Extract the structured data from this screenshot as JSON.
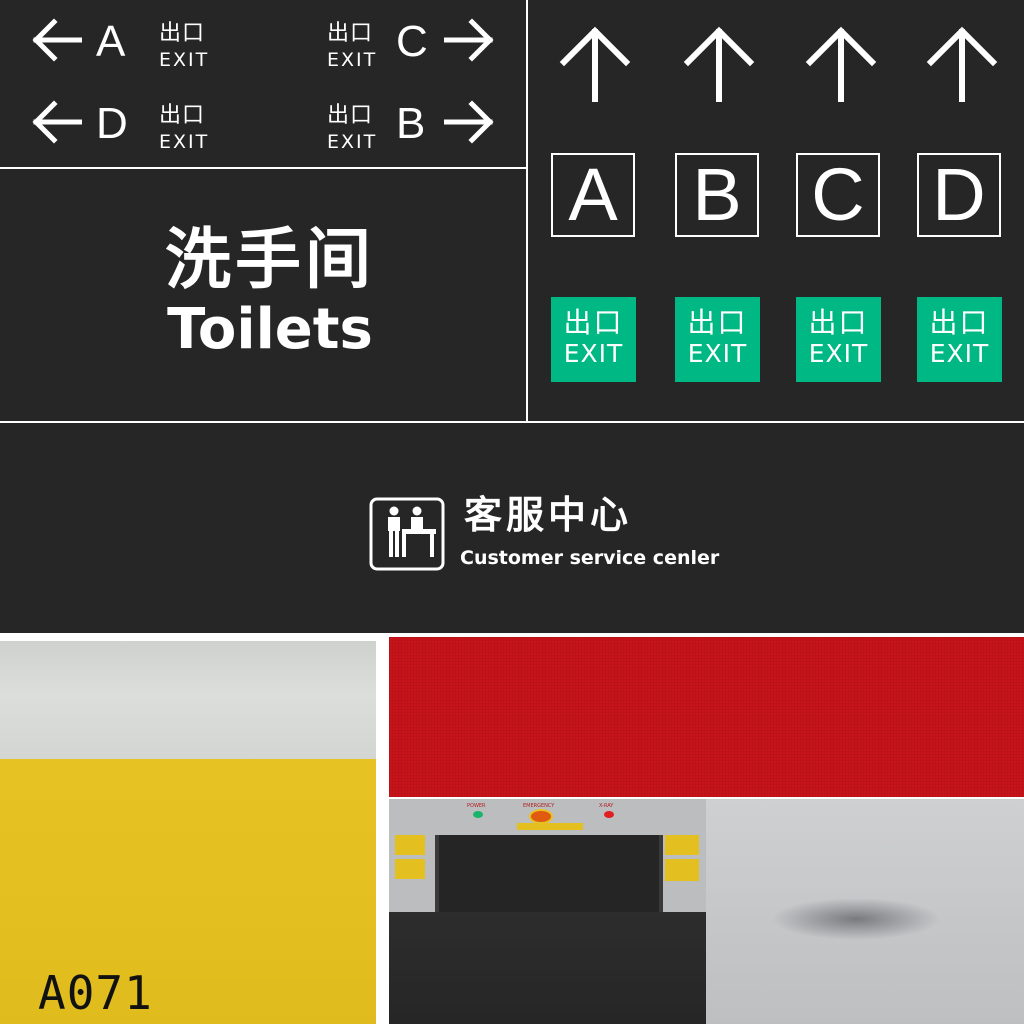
{
  "signs": {
    "exit_directions": [
      {
        "letter": "A",
        "zh": "出口",
        "en": "EXIT",
        "direction": "left"
      },
      {
        "letter": "C",
        "zh": "出口",
        "en": "EXIT",
        "direction": "right"
      },
      {
        "letter": "D",
        "zh": "出口",
        "en": "EXIT",
        "direction": "left"
      },
      {
        "letter": "B",
        "zh": "出口",
        "en": "EXIT",
        "direction": "right"
      }
    ],
    "toilets": {
      "zh": "洗手间",
      "en": "Toilets"
    },
    "gates": [
      {
        "letter": "A",
        "zh": "出口",
        "en": "EXIT"
      },
      {
        "letter": "B",
        "zh": "出口",
        "en": "EXIT"
      },
      {
        "letter": "C",
        "zh": "出口",
        "en": "EXIT"
      },
      {
        "letter": "D",
        "zh": "出口",
        "en": "EXIT"
      }
    ],
    "customer_service": {
      "zh": "客服中心",
      "en": "Customer service cenler",
      "icon": "service-desk-icon"
    }
  },
  "textures": {
    "concrete_yellow": {
      "label": "A071"
    },
    "machine_labels": {
      "power": "POWER",
      "emergency": "EMERGENCY",
      "xray": "X-RAY"
    }
  },
  "colors": {
    "sign_bg": "#262626",
    "exit_green": "#00b884",
    "yellow": "#e3bf1f",
    "red": "#c8131a",
    "steel": "#c9cacc"
  }
}
